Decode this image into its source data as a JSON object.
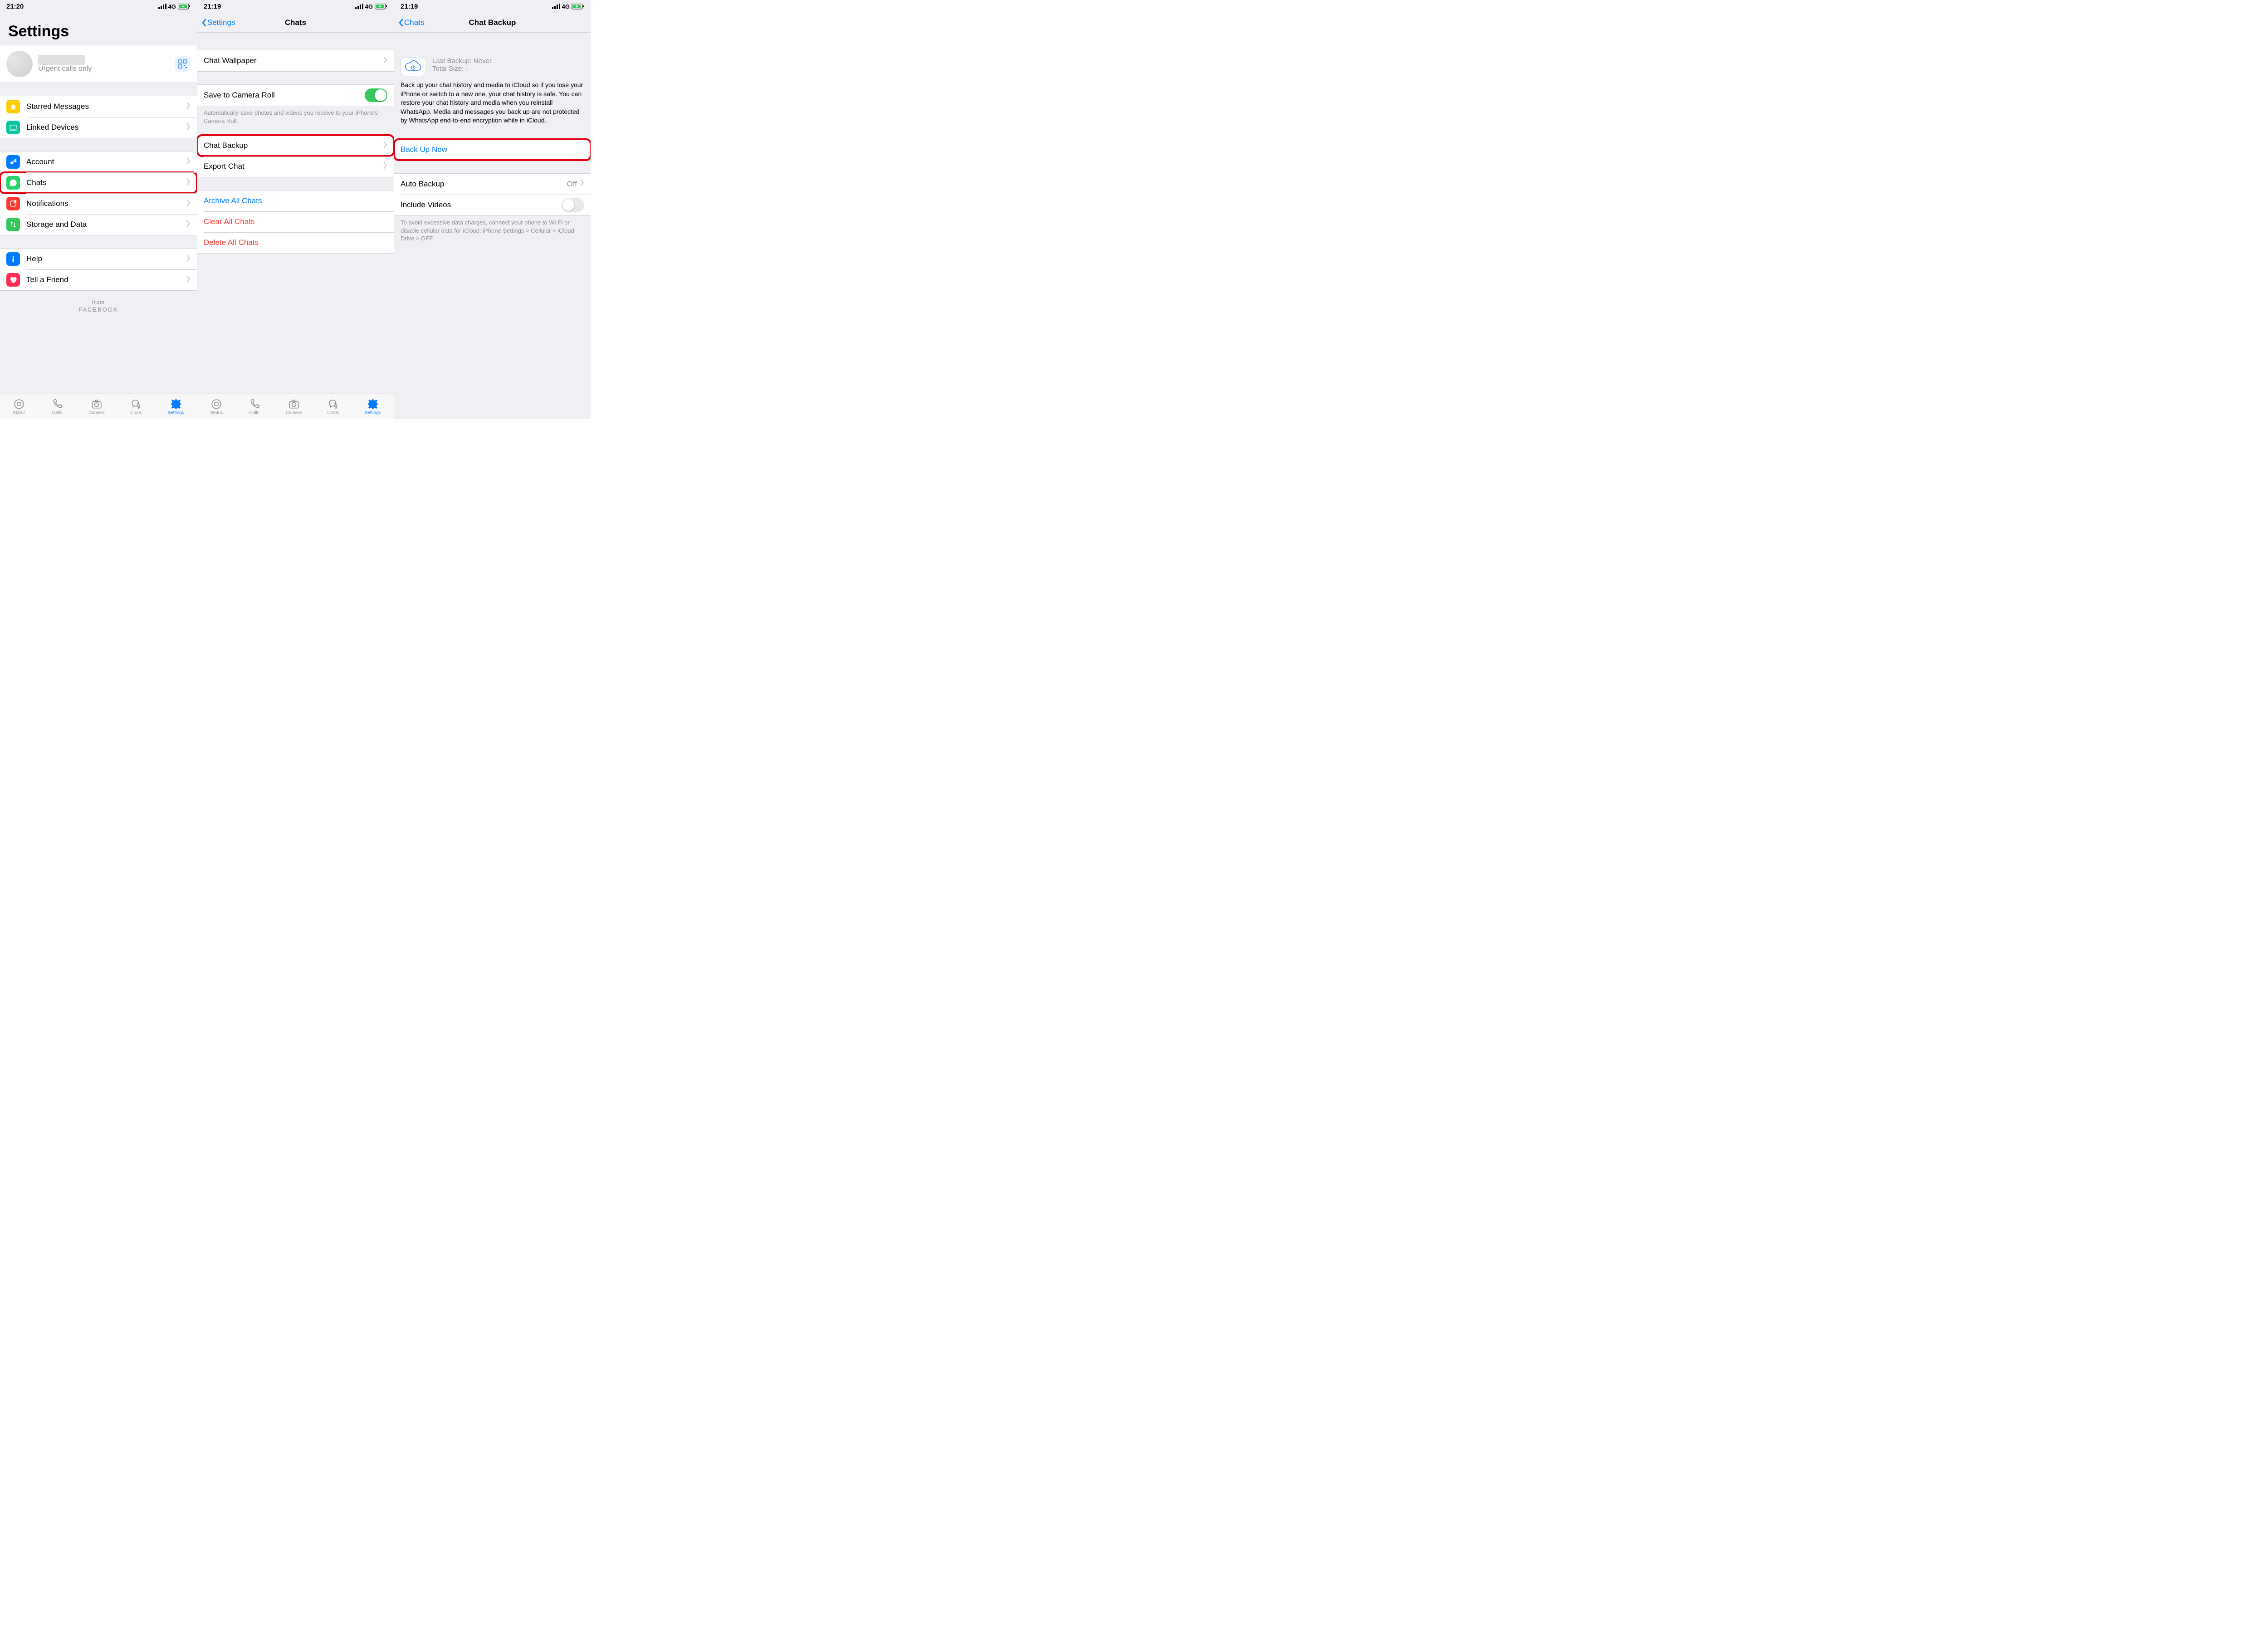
{
  "statusbar": {
    "time1": "21:20",
    "time2": "21:19",
    "time3": "21:19",
    "network": "4G"
  },
  "screen1": {
    "title": "Settings",
    "profile": {
      "status": "Urgent calls only"
    },
    "group1": [
      {
        "label": "Starred Messages",
        "icon": "star",
        "color": "#ffcc00"
      },
      {
        "label": "Linked Devices",
        "icon": "laptop",
        "color": "#07c5a0"
      }
    ],
    "group2": [
      {
        "label": "Account",
        "icon": "key",
        "color": "#007aff"
      },
      {
        "label": "Chats",
        "icon": "whatsapp",
        "color": "#25d366",
        "highlight": true
      },
      {
        "label": "Notifications",
        "icon": "bell",
        "color": "#ff3b30"
      },
      {
        "label": "Storage and Data",
        "icon": "arrows",
        "color": "#34c759"
      }
    ],
    "group3": [
      {
        "label": "Help",
        "icon": "info",
        "color": "#007aff"
      },
      {
        "label": "Tell a Friend",
        "icon": "heart",
        "color": "#ff2d55"
      }
    ],
    "footer": {
      "from": "from",
      "brand": "FACEBOOK"
    }
  },
  "screen2": {
    "back": "Settings",
    "title": "Chats",
    "wallpaper": "Chat Wallpaper",
    "camera_roll": "Save to Camera Roll",
    "camera_roll_desc": "Automatically save photos and videos you receive to your iPhone's Camera Roll.",
    "backup": "Chat Backup",
    "export": "Export Chat",
    "archive": "Archive All Chats",
    "clear": "Clear All Chats",
    "delete": "Delete All Chats"
  },
  "screen3": {
    "back": "Chats",
    "title": "Chat Backup",
    "last_backup_label": "Last Backup:",
    "last_backup_value": "Never",
    "total_size_label": "Total Size:",
    "total_size_value": "-",
    "description": "Back up your chat history and media to iCloud so if you lose your iPhone or switch to a new one, your chat history is safe. You can restore your chat history and media when you reinstall WhatsApp. Media and messages you back up are not protected by WhatsApp end-to-end encryption while in iCloud.",
    "backup_now": "Back Up Now",
    "auto_backup": "Auto Backup",
    "auto_backup_value": "Off",
    "include_videos": "Include Videos",
    "wifi_note": "To avoid excessive data charges, connect your phone to Wi-Fi or disable cellular data for iCloud: iPhone Settings > Cellular > iCloud Drive > OFF."
  },
  "tabs": {
    "status": "Status",
    "calls": "Calls",
    "camera": "Camera",
    "chats": "Chats",
    "settings": "Settings"
  }
}
